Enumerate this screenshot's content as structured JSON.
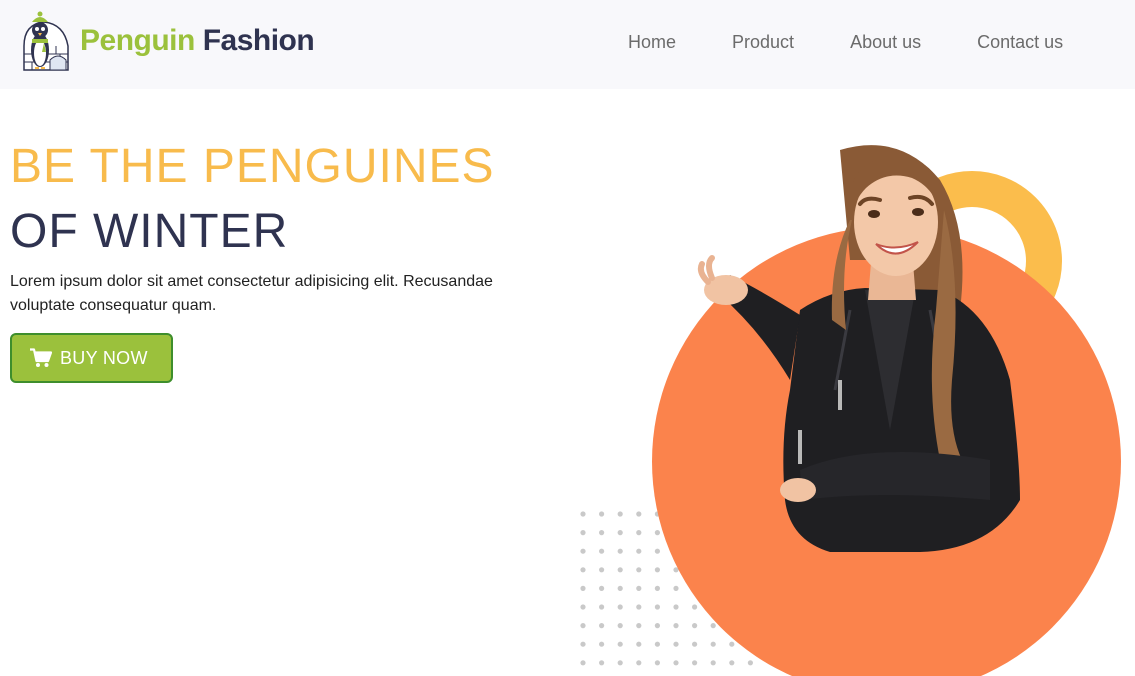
{
  "brand": {
    "name_part1": "Penguin",
    "name_part2": "Fashion",
    "logo_icon": "penguin-igloo-icon"
  },
  "nav": {
    "items": [
      {
        "label": "Home"
      },
      {
        "label": "Product"
      },
      {
        "label": "About us"
      },
      {
        "label": "Contact us"
      }
    ]
  },
  "hero": {
    "title_line1": "BE THE PENGUINES",
    "title_line2": "OF WINTER",
    "description": "Lorem ipsum dolor sit amet consectetur adipisicing elit. Recusandae voluptate consequatur quam.",
    "button_label": "BUY NOW",
    "button_icon": "shopping-cart-icon"
  },
  "colors": {
    "accent_yellow": "#f8bb4c",
    "navy": "#2f3350",
    "green": "#9bc13c",
    "orange": "#fb834c",
    "header_bg": "#f8f8fb"
  }
}
